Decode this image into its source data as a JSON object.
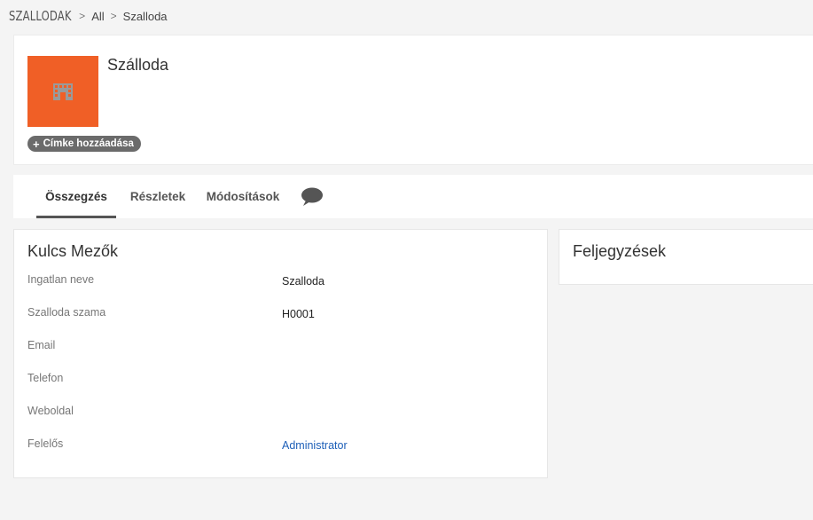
{
  "breadcrumb": {
    "module": "SZALLODAK",
    "all": "All",
    "current": "Szalloda"
  },
  "header": {
    "title": "Szálloda",
    "avatar_color": "#f05f26",
    "avatar_icon": "building-icon",
    "add_tag": "Címke hozzáadása"
  },
  "tabs": [
    {
      "label": "Összegzés",
      "active": true
    },
    {
      "label": "Részletek"
    },
    {
      "label": "Módosítások"
    },
    {
      "icon": "comment-icon"
    }
  ],
  "key_fields": {
    "title": "Kulcs Mezők",
    "rows": [
      {
        "label": "Ingatlan neve",
        "value": "Szalloda"
      },
      {
        "label": "Szalloda szama",
        "value": "H0001"
      },
      {
        "label": "Email",
        "value": ""
      },
      {
        "label": "Telefon",
        "value": ""
      },
      {
        "label": "Weboldal",
        "value": ""
      },
      {
        "label": "Felelős",
        "value": "Administrator",
        "link": true
      }
    ]
  },
  "notes": {
    "title": "Feljegyzések"
  }
}
